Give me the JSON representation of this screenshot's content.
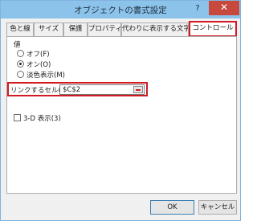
{
  "window": {
    "title": "オブジェクトの書式設定",
    "help_glyph": "?",
    "close_glyph": "✕"
  },
  "tabs": [
    {
      "label": "色と線"
    },
    {
      "label": "サイズ"
    },
    {
      "label": "保護"
    },
    {
      "label": "プロパティ"
    },
    {
      "label": "代わりに表示する文字列"
    },
    {
      "label": "コントロール",
      "active": true
    }
  ],
  "value_group": {
    "label": "値",
    "options": [
      {
        "label": "オフ(F)",
        "selected": false
      },
      {
        "label": "オン(O)",
        "selected": true
      },
      {
        "label": "淡色表示(M)",
        "selected": false
      }
    ]
  },
  "link_cell": {
    "label": "リンクするセル(L):",
    "value": "$C$2"
  },
  "three_d": {
    "label": "3-D 表示(3)",
    "checked": false
  },
  "buttons": {
    "ok": "OK",
    "cancel": "キャンセル"
  },
  "colors": {
    "titlebar": "#8cc3ea",
    "close": "#c7493e",
    "highlight": "#d21a24"
  }
}
